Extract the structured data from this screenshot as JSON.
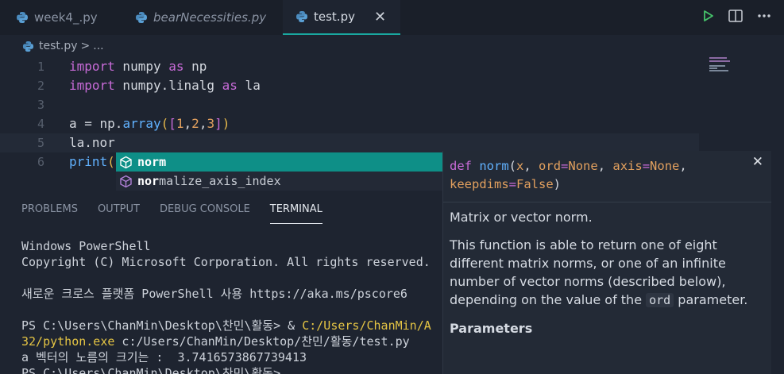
{
  "tabs": [
    {
      "label": "week4_.py",
      "italic": false
    },
    {
      "label": "bearNecessities.py",
      "italic": true
    },
    {
      "label": "test.py",
      "italic": false,
      "close": "✕"
    }
  ],
  "breadcrumb": {
    "file": "test.py",
    "separator": ">",
    "more": "..."
  },
  "editor": {
    "line_numbers": [
      "1",
      "2",
      "3",
      "4",
      "5",
      "6"
    ],
    "line1": {
      "kw1": "import",
      "mod": " numpy ",
      "kw2": "as",
      "alias": " np"
    },
    "line2": {
      "kw1": "import",
      "mod": " numpy.linalg ",
      "kw2": "as",
      "alias": " la"
    },
    "line4": {
      "a": "a = np.",
      "fn": "array",
      "open": "(",
      "lb": "[",
      "n1": "1",
      "c1": ",",
      "n2": "2",
      "c2": ",",
      "n3": "3",
      "rb": "]",
      "close": ")"
    },
    "line5": "la.nor",
    "line6": {
      "fn": "print",
      "open": "("
    }
  },
  "suggestions": [
    {
      "match": "nor",
      "rest": "m",
      "full": "norm"
    },
    {
      "match": "nor",
      "rest": "malize_axis_index",
      "full": "normalize_axis_index"
    }
  ],
  "panel_tabs": [
    "PROBLEMS",
    "OUTPUT",
    "DEBUG CONSOLE",
    "TERMINAL"
  ],
  "terminal": {
    "l1": "Windows PowerShell",
    "l2": "Copyright (C) Microsoft Corporation. All rights reserved.",
    "l3": "새로운 크로스 플랫폼 PowerShell 사용 https://aka.ms/pscore6",
    "l4a": "PS C:\\Users\\ChanMin\\Desktop\\찬민\\활동> & ",
    "l4b": "C:/Users/ChanMin/A",
    "l5a": "32/python.exe",
    "l5b": " c:/Users/ChanMin/Desktop/찬민/활동/test.py",
    "l6": "a 벡터의 노름의 크기는 :  3.7416573867739413",
    "l7": "PS C:\\Users\\ChanMin\\Desktop\\찬민\\활동>"
  },
  "hover": {
    "sig_def": "def",
    "sig_name": "norm",
    "sig_params": "(x, ord=None, axis=None, keepdims=False)",
    "s_open": "(",
    "s_x": "x",
    "s_c1": ", ",
    "s_ord": "ord",
    "s_eq": "=",
    "s_none": "None",
    "s_c2": ", ",
    "s_axis": "axis",
    "s_none2": "None",
    "s_c3": ",",
    "s_keep": "keepdims",
    "s_false": "False",
    "s_close": ")",
    "close": "✕",
    "summary": "Matrix or vector norm.",
    "desc_pre": "This function is able to return one of eight different matrix norms, or one of an infinite number of vector norms (described below), depending on the value of the ",
    "desc_code": "ord",
    "desc_post": " parameter.",
    "params_heading": "Parameters"
  },
  "colors": {
    "accent": "#0e8f87",
    "keyword": "#c86bd8",
    "function": "#61b2ff",
    "number": "#e2a05e",
    "run": "#45c26a"
  }
}
